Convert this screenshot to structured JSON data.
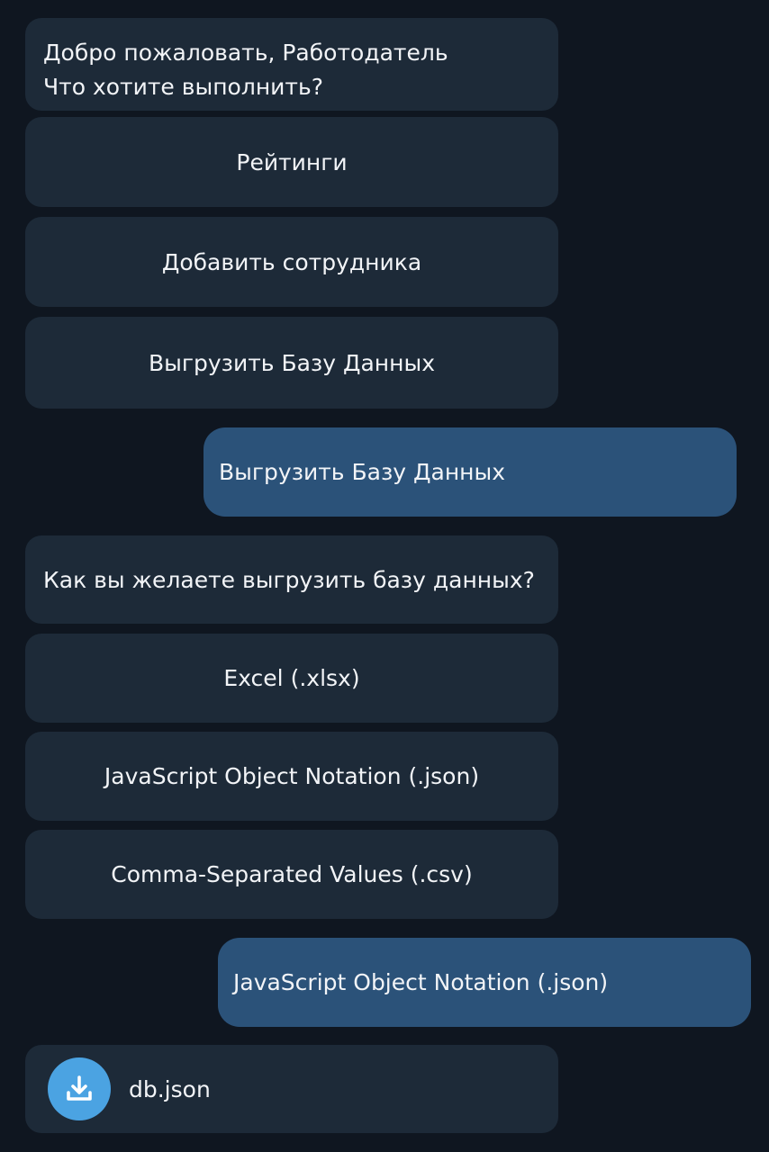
{
  "greeting": {
    "line1": "Добро пожаловать, Работодатель",
    "line2": "Что хотите выполнить?"
  },
  "main_menu": {
    "ratings": "Рейтинги",
    "add_employee": "Добавить сотрудника",
    "export_db": "Выгрузить Базу Данных"
  },
  "user_reply_1": "Выгрузить Базу Данных",
  "export_question": "Как вы желаете выгрузить базу данных?",
  "format_menu": {
    "excel": "Excel (.xlsx)",
    "json": "JavaScript Object Notation (.json)",
    "csv": "Comma-Separated Values (.csv)"
  },
  "user_reply_2": "JavaScript Object Notation (.json)",
  "file": {
    "name": "db.json",
    "icon": "download-icon"
  },
  "colors": {
    "background": "#0f1620",
    "incoming_bubble": "#1d2a38",
    "outgoing_bubble": "#2b5279",
    "download_button": "#4ba3e2"
  }
}
